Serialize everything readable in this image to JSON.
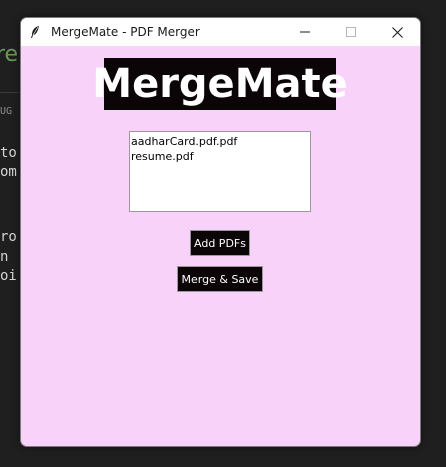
{
  "background": {
    "fragments": [
      "re",
      "UG",
      "to",
      "om",
      "ro",
      "n",
      "oi"
    ]
  },
  "window": {
    "title": "MergeMate - PDF Merger",
    "app_icon": "feather-icon",
    "controls": {
      "minimize_icon": "minimize-icon",
      "maximize_icon": "maximize-icon",
      "close_icon": "close-icon"
    }
  },
  "app": {
    "logo_text": "MergeMate",
    "files": [
      "aadharCard.pdf.pdf",
      "resume.pdf"
    ],
    "add_button_label": "Add PDFs",
    "merge_button_label": "Merge & Save"
  },
  "colors": {
    "window_bg": "#f9d2f9",
    "button_bg": "#0b0507",
    "button_text": "#ffffff",
    "logo_bg": "#0b0507"
  }
}
